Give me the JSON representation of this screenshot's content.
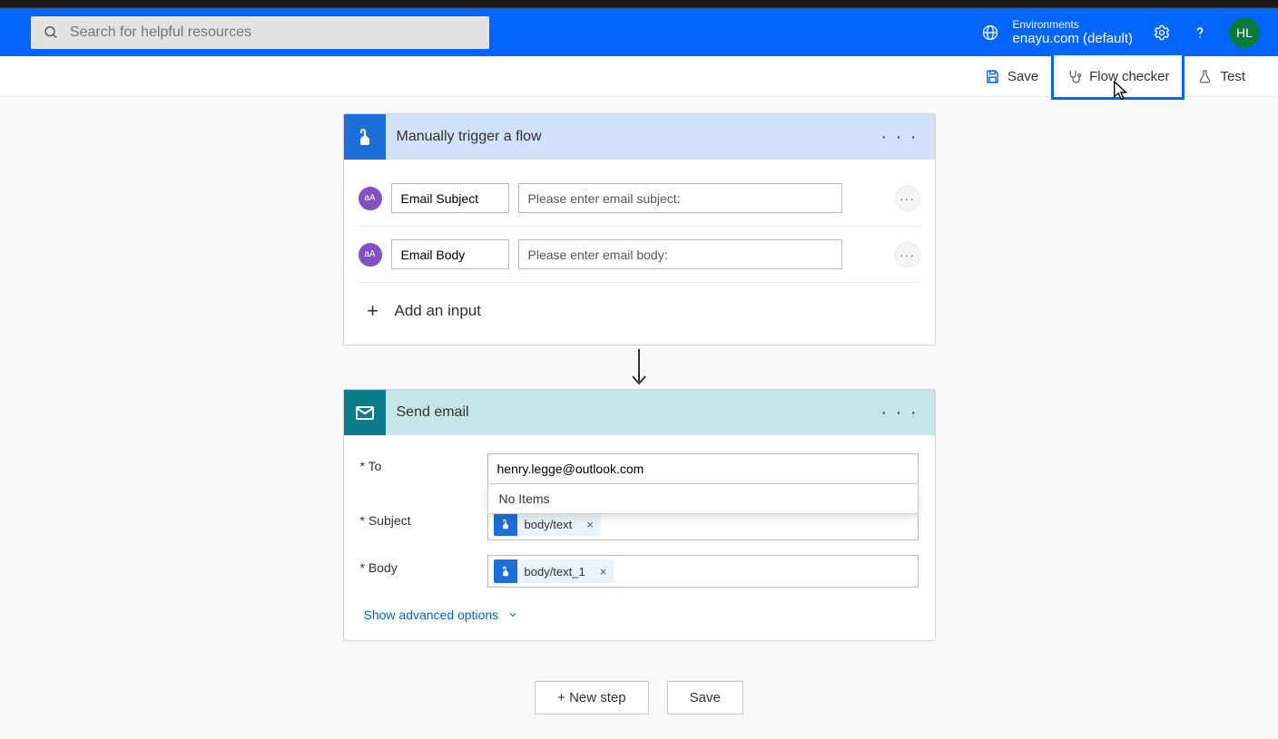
{
  "header": {
    "search_placeholder": "Search for helpful resources",
    "env_label": "Environments",
    "env_name": "enayu.com (default)",
    "avatar_initials": "HL"
  },
  "commandbar": {
    "save": "Save",
    "flow_checker": "Flow checker",
    "test": "Test"
  },
  "trigger_card": {
    "title": "Manually trigger a flow",
    "inputs": [
      {
        "name": "Email Subject",
        "placeholder": "Please enter email subject:",
        "type_badge": "aA"
      },
      {
        "name": "Email Body",
        "placeholder": "Please enter email body:",
        "type_badge": "aA"
      }
    ],
    "add_input_label": "Add an input"
  },
  "action_card": {
    "title": "Send email",
    "fields": {
      "to_label": "* To",
      "to_value": "henry.legge@outlook.com",
      "dropdown_text": "No Items",
      "subject_label": "* Subject",
      "subject_token": "body/text",
      "body_label": "* Body",
      "body_token": "body/text_1"
    },
    "advanced_label": "Show advanced options"
  },
  "footer": {
    "new_step": "+ New step",
    "save": "Save"
  }
}
